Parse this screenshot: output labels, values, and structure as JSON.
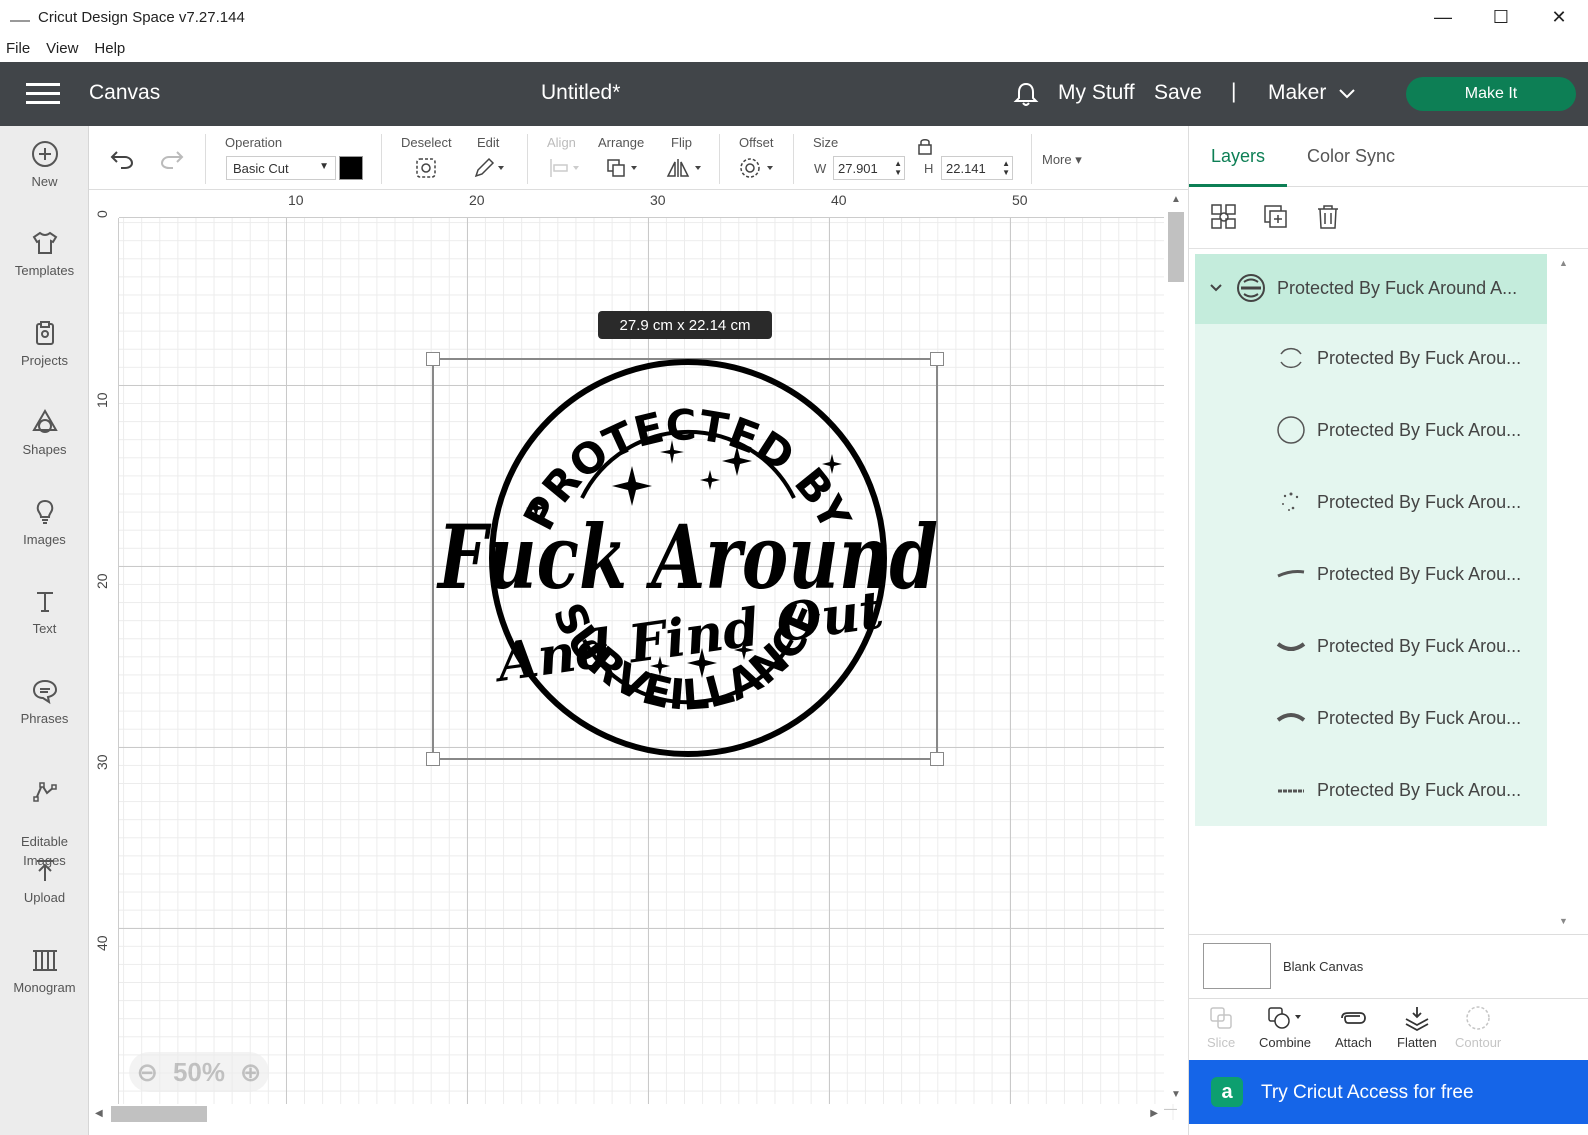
{
  "window": {
    "title": "Cricut Design Space  v7.27.144",
    "controls": [
      "—",
      "☐",
      "✕"
    ]
  },
  "menu": [
    "File",
    "View",
    "Help"
  ],
  "header": {
    "section": "Canvas",
    "doc_title": "Untitled*",
    "my_stuff": "My Stuff",
    "save": "Save",
    "separator": "|",
    "machine": "Maker",
    "make_it": "Make It",
    "make_it_color": "#0d7f55"
  },
  "sidebar": {
    "items": [
      {
        "label": "New",
        "icon": "plus-circle-icon"
      },
      {
        "label": "Templates",
        "icon": "tshirt-icon"
      },
      {
        "label": "Projects",
        "icon": "clipboard-icon"
      },
      {
        "label": "Shapes",
        "icon": "shapes-icon"
      },
      {
        "label": "Images",
        "icon": "lightbulb-icon"
      },
      {
        "label": "Text",
        "icon": "text-icon"
      },
      {
        "label": "Phrases",
        "icon": "speech-bubble-icon"
      },
      {
        "label": "Editable\nImages",
        "icon": "editable-image-icon"
      },
      {
        "label": "Upload",
        "icon": "upload-icon"
      },
      {
        "label": "Monogram",
        "icon": "monogram-icon"
      }
    ]
  },
  "toolbar": {
    "operation_label": "Operation",
    "operation_value": "Basic Cut",
    "deselect": "Deselect",
    "edit": "Edit",
    "align": "Align",
    "arrange": "Arrange",
    "flip": "Flip",
    "offset": "Offset",
    "size": "Size",
    "w_label": "W",
    "w_value": "27.901",
    "h_label": "H",
    "h_value": "22.141",
    "more": "More"
  },
  "ruler": {
    "top": [
      "10",
      "20",
      "30",
      "40",
      "50"
    ],
    "left": [
      "0",
      "10",
      "20",
      "30",
      "40"
    ]
  },
  "canvas": {
    "size_tooltip": "27.9  cm x 22.14  cm",
    "design_text": {
      "top_arc": "PROTECTED BY",
      "main": "Fuck Around",
      "sub": "And Find Out",
      "bottom_arc": "SURVEILLANCE"
    },
    "zoom": "50%"
  },
  "panel": {
    "tabs": [
      "Layers",
      "Color Sync"
    ],
    "group_name": "Protected By Fuck Around A...",
    "layers": [
      "Protected By Fuck Arou...",
      "Protected By Fuck Arou...",
      "Protected By Fuck Arou...",
      "Protected By Fuck Arou...",
      "Protected By Fuck Arou...",
      "Protected By Fuck Arou...",
      "Protected By Fuck Arou..."
    ],
    "blank_canvas": "Blank Canvas",
    "ops": [
      "Slice",
      "Combine",
      "Attach",
      "Flatten",
      "Contour"
    ],
    "access_logo": "a",
    "access": "Try Cricut Access for free",
    "access_color": "#1565e8"
  }
}
